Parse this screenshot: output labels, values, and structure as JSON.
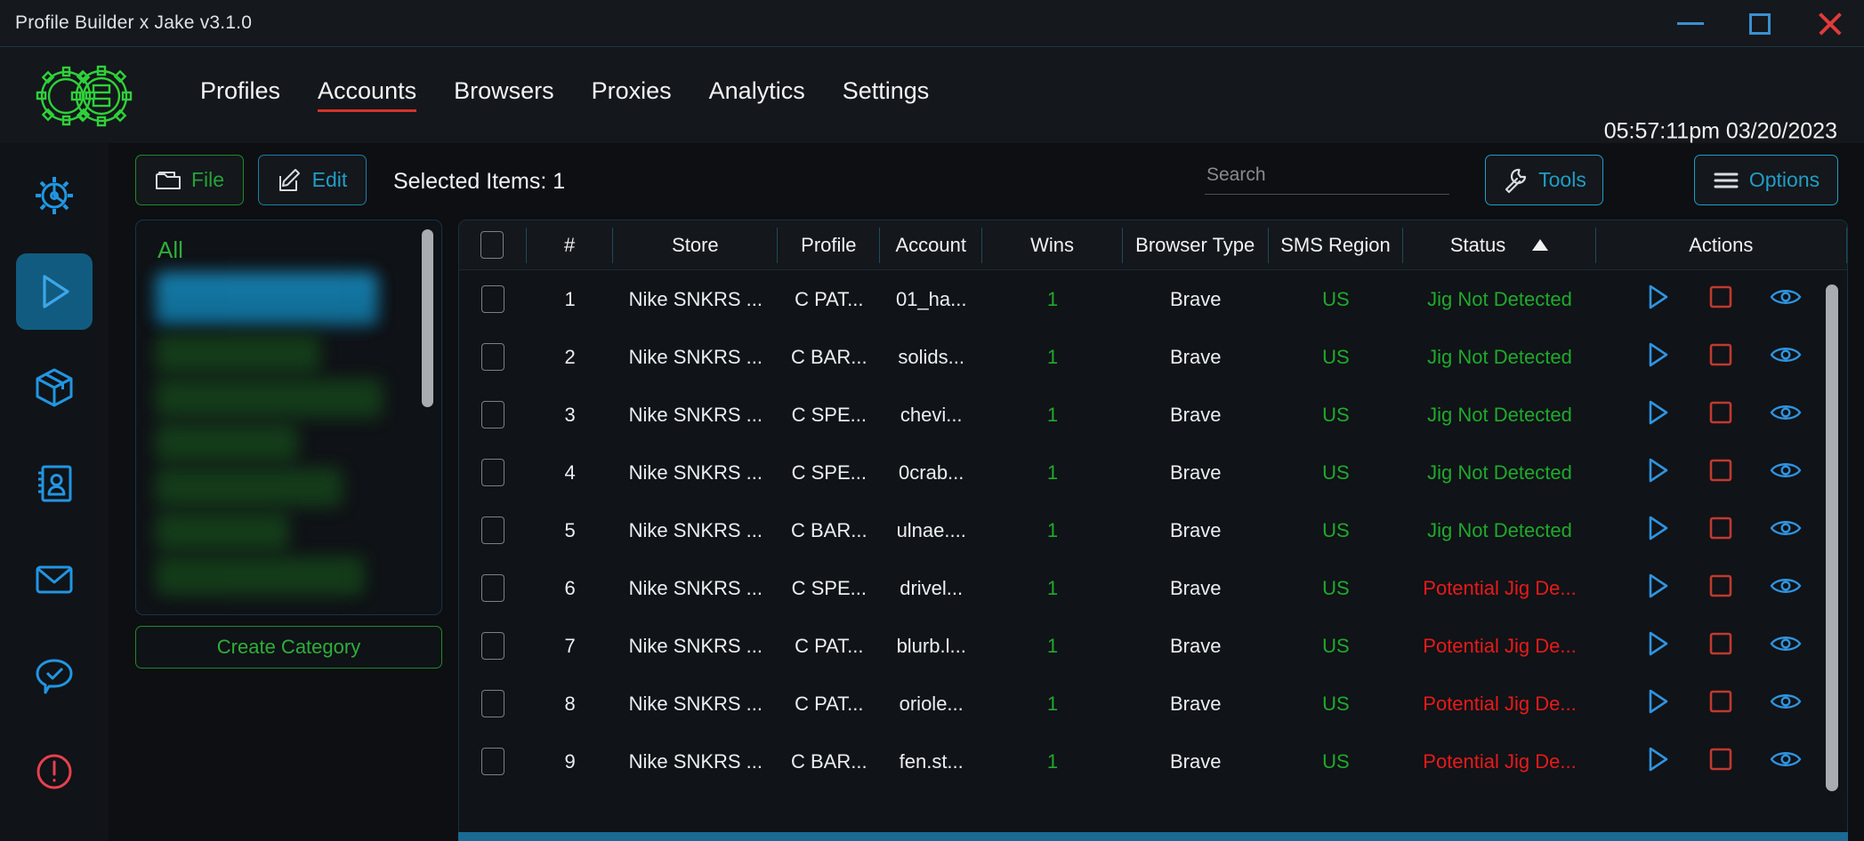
{
  "window": {
    "title": "Profile Builder x Jake v3.1.0",
    "minimize_icon": "minimize-icon",
    "maximize_icon": "maximize-icon",
    "close_icon": "close-icon"
  },
  "header": {
    "logo_icon": "gears-logo-icon",
    "datetime": "05:57:11pm 03/20/2023",
    "nav": [
      {
        "label": "Profiles",
        "active": false
      },
      {
        "label": "Accounts",
        "active": true
      },
      {
        "label": "Browsers",
        "active": false
      },
      {
        "label": "Proxies",
        "active": false
      },
      {
        "label": "Analytics",
        "active": false
      },
      {
        "label": "Settings",
        "active": false
      }
    ]
  },
  "rail": [
    {
      "name": "settings-gear-icon",
      "active": false
    },
    {
      "name": "run-play-icon",
      "active": true
    },
    {
      "name": "package-box-icon",
      "active": false
    },
    {
      "name": "contacts-book-icon",
      "active": false
    },
    {
      "name": "mail-envelope-icon",
      "active": false
    },
    {
      "name": "chat-check-icon",
      "active": false
    },
    {
      "name": "alert-error-icon",
      "active": false
    }
  ],
  "toolbar": {
    "file_label": "File",
    "file_icon": "folder-icon",
    "edit_label": "Edit",
    "edit_icon": "pencil-edit-icon",
    "selected_items": "Selected Items: 1",
    "search_placeholder": "Search",
    "search_value": "",
    "tools_label": "Tools",
    "tools_icon": "wrench-icon",
    "options_label": "Options",
    "options_icon": "hamburger-menu-icon"
  },
  "categories": {
    "all_label": "All",
    "create_label": "Create Category"
  },
  "table": {
    "columns": [
      {
        "key": "check",
        "label": ""
      },
      {
        "key": "num",
        "label": "#"
      },
      {
        "key": "store",
        "label": "Store"
      },
      {
        "key": "profile",
        "label": "Profile"
      },
      {
        "key": "account",
        "label": "Account"
      },
      {
        "key": "wins",
        "label": "Wins"
      },
      {
        "key": "btype",
        "label": "Browser Type"
      },
      {
        "key": "sms",
        "label": "SMS Region"
      },
      {
        "key": "status",
        "label": "Status"
      },
      {
        "key": "actions",
        "label": "Actions"
      }
    ],
    "sorted_column": "Status",
    "sort_direction": "ascending",
    "action_icons": [
      "play-icon",
      "stop-icon",
      "eye-view-icon"
    ],
    "rows": [
      {
        "num": "1",
        "store": "Nike SNKRS ...",
        "profile": "C PAT...",
        "account": "01_ha...",
        "wins": "1",
        "btype": "Brave",
        "sms": "US",
        "status": "Jig Not Detected",
        "status_state": "ok"
      },
      {
        "num": "2",
        "store": "Nike SNKRS ...",
        "profile": "C BAR...",
        "account": "solids...",
        "wins": "1",
        "btype": "Brave",
        "sms": "US",
        "status": "Jig Not Detected",
        "status_state": "ok"
      },
      {
        "num": "3",
        "store": "Nike SNKRS ...",
        "profile": "C SPE...",
        "account": "chevi...",
        "wins": "1",
        "btype": "Brave",
        "sms": "US",
        "status": "Jig Not Detected",
        "status_state": "ok"
      },
      {
        "num": "4",
        "store": "Nike SNKRS ...",
        "profile": "C SPE...",
        "account": "0crab...",
        "wins": "1",
        "btype": "Brave",
        "sms": "US",
        "status": "Jig Not Detected",
        "status_state": "ok"
      },
      {
        "num": "5",
        "store": "Nike SNKRS ...",
        "profile": "C BAR...",
        "account": "ulnae....",
        "wins": "1",
        "btype": "Brave",
        "sms": "US",
        "status": "Jig Not Detected",
        "status_state": "ok"
      },
      {
        "num": "6",
        "store": "Nike SNKRS ...",
        "profile": "C SPE...",
        "account": "drivel...",
        "wins": "1",
        "btype": "Brave",
        "sms": "US",
        "status": "Potential Jig De...",
        "status_state": "alert"
      },
      {
        "num": "7",
        "store": "Nike SNKRS ...",
        "profile": "C PAT...",
        "account": "blurb.l...",
        "wins": "1",
        "btype": "Brave",
        "sms": "US",
        "status": "Potential Jig De...",
        "status_state": "alert"
      },
      {
        "num": "8",
        "store": "Nike SNKRS ...",
        "profile": "C PAT...",
        "account": "oriole...",
        "wins": "1",
        "btype": "Brave",
        "sms": "US",
        "status": "Potential Jig De...",
        "status_state": "alert"
      },
      {
        "num": "9",
        "store": "Nike SNKRS ...",
        "profile": "C BAR...",
        "account": "fen.st...",
        "wins": "1",
        "btype": "Brave",
        "sms": "US",
        "status": "Potential Jig De...",
        "status_state": "alert"
      }
    ]
  },
  "colors": {
    "accent_green": "#25a23a",
    "accent_cyan": "#1f9ec6",
    "accent_red": "#d4342a",
    "status_ok": "#1faa2c",
    "status_alert": "#e81a1a",
    "selected_row": "#13587d",
    "background": "#0d0f12"
  }
}
